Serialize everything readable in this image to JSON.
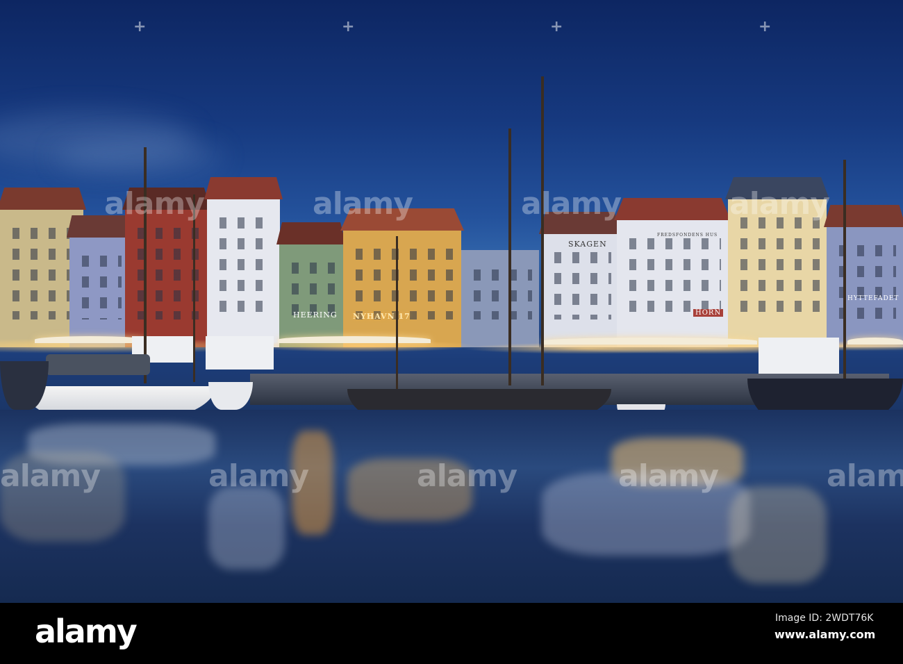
{
  "photo": {
    "subject": "Nyhavn harbour at dusk",
    "signs": {
      "heering": "HEERING",
      "nyhavn": "NYHAVN 17",
      "skagen": "SKAGEN",
      "fredsfondens": "FREDSFONDENS HUS",
      "horn": "HORN",
      "hyttefadet": "HYTTEFADET"
    },
    "watermark": "alamy",
    "plus_mark": "+"
  },
  "footer": {
    "logo": "alamy",
    "image_id": "Image ID: 2WDT76K",
    "website": "www.alamy.com"
  }
}
